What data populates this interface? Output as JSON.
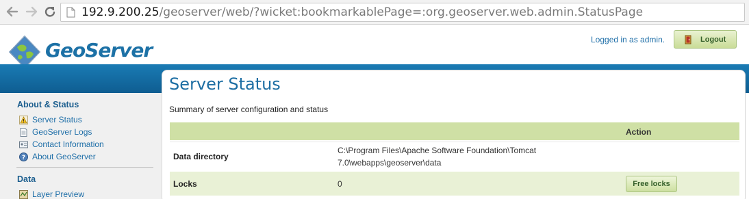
{
  "browser": {
    "url_host": "192.9.200.25",
    "url_path": "/geoserver/web/?wicket:bookmarkablePage=:org.geoserver.web.admin.StatusPage"
  },
  "header": {
    "logo_text": "GeoServer",
    "logged_in_text": "Logged in as admin.",
    "logout_label": "Logout"
  },
  "sidebar": {
    "sections": [
      {
        "heading": "About & Status",
        "items": [
          {
            "label": "Server Status",
            "icon": "warning-icon"
          },
          {
            "label": "GeoServer Logs",
            "icon": "document-icon"
          },
          {
            "label": "Contact Information",
            "icon": "contact-card-icon"
          },
          {
            "label": "About GeoServer",
            "icon": "help-icon"
          }
        ]
      },
      {
        "heading": "Data",
        "items": [
          {
            "label": "Layer Preview",
            "icon": "map-icon"
          }
        ]
      }
    ]
  },
  "main": {
    "title": "Server Status",
    "subtitle": "Summary of server configuration and status",
    "table": {
      "action_header": "Action",
      "rows": [
        {
          "label": "Data directory",
          "value_line1": "C:\\Program Files\\Apache Software Foundation\\Tomcat",
          "value_line2": "7.0\\webapps\\geoserver\\data"
        },
        {
          "label": "Locks",
          "value": "0",
          "action_label": "Free locks"
        }
      ]
    }
  },
  "colors": {
    "brand_blue": "#1c71a6",
    "band_blue": "#1a7bb4",
    "table_header_green": "#cfe0a5",
    "row_alt_green": "#e9f1d6"
  }
}
